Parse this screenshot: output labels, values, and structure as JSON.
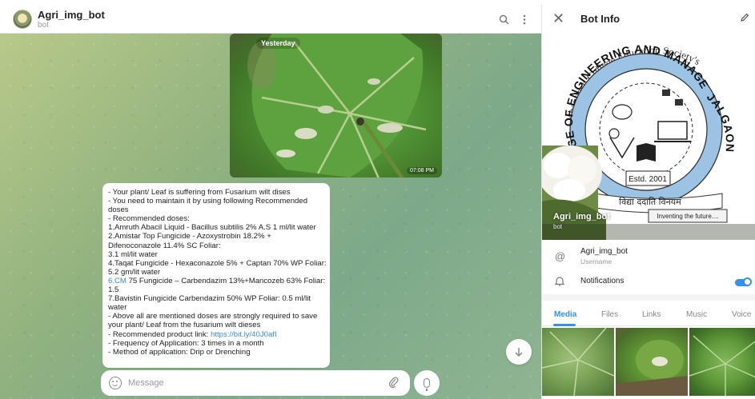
{
  "chat": {
    "title": "Agri_img_bot",
    "subtitle": "bot",
    "date_chip": "Yesterday",
    "photo_time": "07:08 PM",
    "message_lines": [
      "- Your plant/ Leaf is suffering from Fusarium wilt dises",
      "- You need to maintain it by using following Recommended",
      "doses",
      "- Recommended doses:",
      "1.Amruth Abacil Liquid - Bacillus subtilis 2% A.S 1 ml/lit water",
      "2.Amistar Top Fungicide - Azoxystrobin 18.2% +",
      "Difenoconazole 11.4% SC Foliar:",
      "3.1 ml/lit water",
      "4.Taqat Fungicide - Hexaconazole 5% + Captan 70% WP Foliar:",
      "5.2 gm/lit water",
      "75 Fungicide – Carbendazim 13%+Mancozeb 63% Foliar:",
      "1.5",
      "7.Bavistin Fungicide Carbendazim 50% WP Foliar: 0.5 ml/lit",
      "water",
      "- Above all are mentioned doses are strongly required to save",
      "your plant/ Leaf from the fusarium wilt dieses",
      "- Recommended product link: ",
      "- Frequency of Application: 3 times in a month",
      "- Method of application: Drip or Drenching"
    ],
    "line11_link": "6.CM",
    "product_link": "https://bit.ly/40J0afI",
    "composer_placeholder": "Message"
  },
  "info": {
    "title": "Bot Info",
    "name": "Agri_img_bot",
    "name_sub": "bot",
    "logo": {
      "arc_text": "Khandesh College Education Society's",
      "ring_text_left": "EGE OF ENGINEERING AND MANAGEMENT",
      "ring_text_right": "JALGAON",
      "established": "Estd. 2001",
      "motto": "विद्या ददाति विनयम",
      "tagline": "Inventing the future...."
    },
    "username_value": "Agri_img_bot",
    "username_label": "Username",
    "notifications_label": "Notifications",
    "notifications_on": true,
    "tabs": [
      "Media",
      "Files",
      "Links",
      "Music",
      "Voice"
    ],
    "active_tab": "Media"
  },
  "icons": {
    "search": "search-icon",
    "more": "more-vertical-icon",
    "close": "close-icon",
    "edit": "pencil-icon",
    "mention": "at-icon",
    "bell": "bell-icon",
    "attach": "paperclip-icon",
    "mic": "microphone-icon",
    "scroll": "arrow-down-icon",
    "emoji": "smiley-icon"
  },
  "colors": {
    "accent": "#3390ec",
    "link": "#3a8ad9"
  }
}
